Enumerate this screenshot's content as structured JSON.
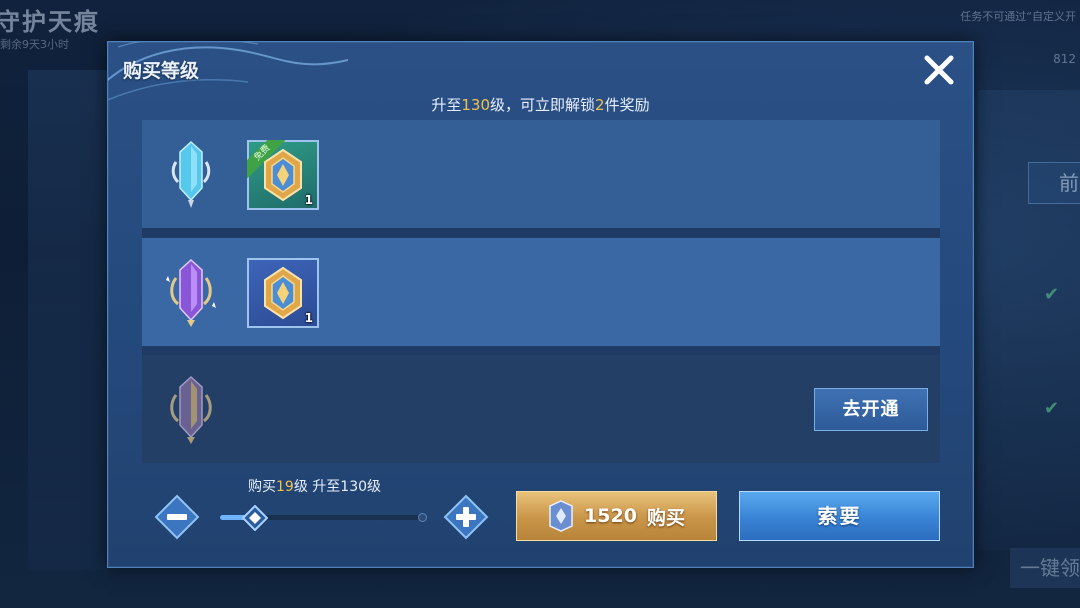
{
  "background": {
    "title": "守护天痕",
    "subtitle": "剩余9天3小时",
    "tip": "任务不可通过“自定义开",
    "number": "812",
    "right_button": "前",
    "bottom_button": "一键领"
  },
  "dialog": {
    "title": "购买等级",
    "subtitle": {
      "prefix": "升至",
      "level": "130",
      "mid": "级，可立即解锁",
      "count": "2",
      "suffix": "件奖励"
    },
    "rows": [
      {
        "tier": "free",
        "item_qty": "1",
        "tag": "免费"
      },
      {
        "tier": "premium",
        "item_qty": "1"
      },
      {
        "tier": "locked",
        "action_label": "去开通"
      }
    ],
    "buy_info": {
      "prefix": "购买",
      "levels": "19",
      "mid": "级 升至",
      "target": "130",
      "suffix": "级"
    },
    "slider_value": 0.17,
    "buy_button": {
      "price": "1520",
      "label": "购买"
    },
    "ask_button": "索要"
  },
  "colors": {
    "gold": "#f2c14a",
    "dialog_bg": "#2a5086",
    "buy_button": "#c99548",
    "ask_button": "#3a83d4"
  }
}
